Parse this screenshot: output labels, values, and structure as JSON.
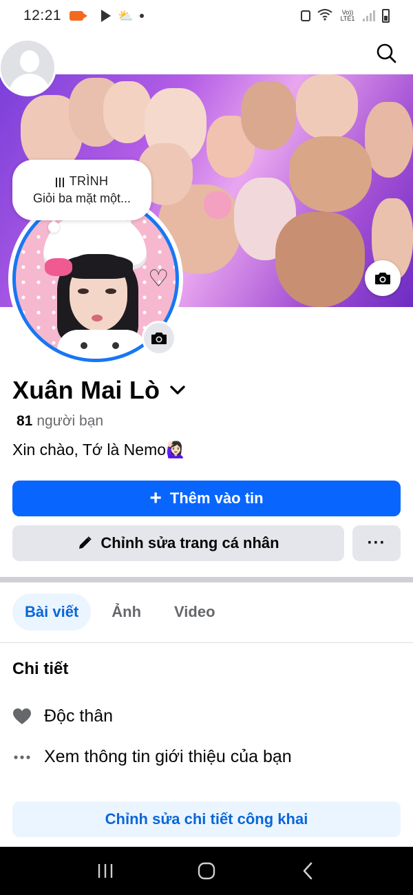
{
  "status_bar": {
    "time": "12:21",
    "network_label": "Vo)) LTE1"
  },
  "note": {
    "title": "TRÌNH",
    "text": "Giỏi ba mặt một..."
  },
  "profile": {
    "name": "Xuân Mai Lò",
    "friends_count": "81",
    "friends_label": "người bạn",
    "bio": "Xin chào, Tớ là Nemo🙋🏻‍♀️"
  },
  "buttons": {
    "add_story": "Thêm vào tin",
    "edit_profile": "Chỉnh sửa trang cá nhân",
    "more": "···"
  },
  "tabs": [
    {
      "label": "Bài viết",
      "active": true
    },
    {
      "label": "Ảnh",
      "active": false
    },
    {
      "label": "Video",
      "active": false
    }
  ],
  "details": {
    "title": "Chi tiết",
    "items": [
      {
        "icon": "heart-icon",
        "text": "Độc thân"
      },
      {
        "icon": "more-horizontal-icon",
        "text": "Xem thông tin giới thiệu của bạn"
      }
    ],
    "edit_button": "Chỉnh sửa chi tiết công khai"
  },
  "colors": {
    "primary": "#0866ff",
    "secondary_button": "#e4e6eb",
    "tab_active_bg": "#ebf5ff",
    "tab_active_text": "#0a66d8",
    "profile_ring": "#1877f2"
  }
}
